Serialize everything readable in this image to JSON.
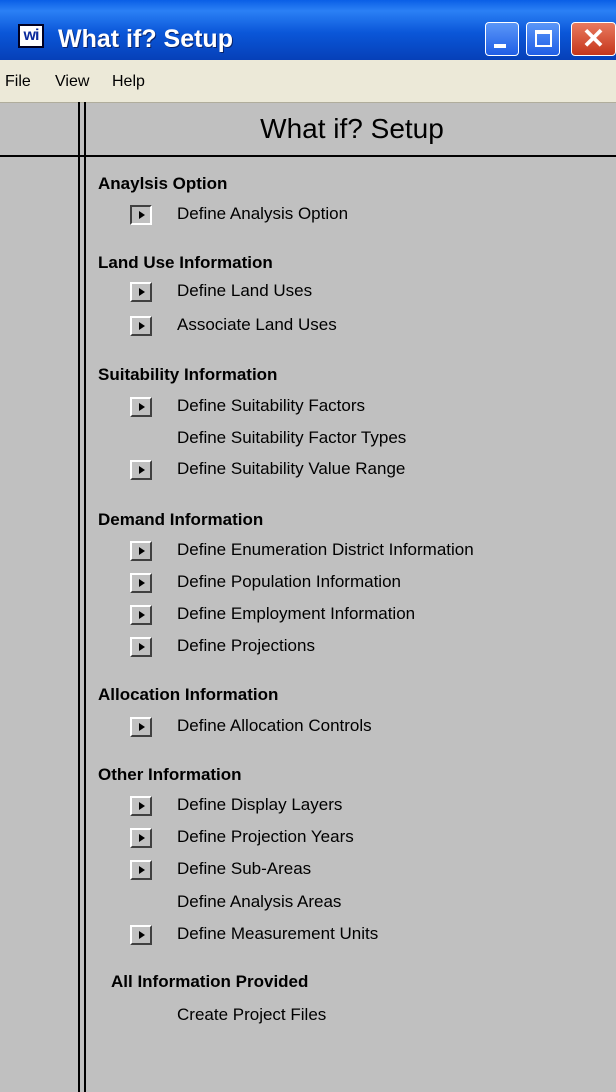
{
  "window": {
    "title": "What if? Setup",
    "icon_text": "wi",
    "close_glyph": "✕"
  },
  "menu": [
    {
      "label": "File"
    },
    {
      "label": "View"
    },
    {
      "label": "Help"
    }
  ],
  "header": {
    "title": "What if? Setup"
  },
  "sections": {
    "analysis": {
      "heading": "Anaylsis Option",
      "items": [
        {
          "label": "Define Analysis Option",
          "has_button": true
        }
      ]
    },
    "land_use": {
      "heading": "Land Use Information",
      "items": [
        {
          "label": "Define Land Uses",
          "has_button": true
        },
        {
          "label": "Associate Land Uses",
          "has_button": true
        }
      ]
    },
    "suitability": {
      "heading": "Suitability Information",
      "items": [
        {
          "label": "Define Suitability Factors",
          "has_button": true
        },
        {
          "label": "Define Suitability Factor Types",
          "has_button": false
        },
        {
          "label": "Define Suitability Value Range",
          "has_button": true
        }
      ]
    },
    "demand": {
      "heading": "Demand Information",
      "items": [
        {
          "label": "Define Enumeration District Information",
          "has_button": true
        },
        {
          "label": "Define Population Information",
          "has_button": true
        },
        {
          "label": "Define Employment Information",
          "has_button": true
        },
        {
          "label": "Define Projections",
          "has_button": true
        }
      ]
    },
    "allocation": {
      "heading": "Allocation Information",
      "items": [
        {
          "label": "Define Allocation Controls",
          "has_button": true
        }
      ]
    },
    "other": {
      "heading": "Other Information",
      "items": [
        {
          "label": "Define Display Layers",
          "has_button": true
        },
        {
          "label": "Define Projection Years",
          "has_button": true
        },
        {
          "label": "Define Sub-Areas",
          "has_button": true
        },
        {
          "label": "Define Analysis Areas",
          "has_button": false
        },
        {
          "label": "Define Measurement Units",
          "has_button": true
        }
      ]
    },
    "all_info": {
      "heading": "All Information Provided",
      "items": [
        {
          "label": "Create Project Files",
          "has_button": false
        }
      ]
    }
  }
}
